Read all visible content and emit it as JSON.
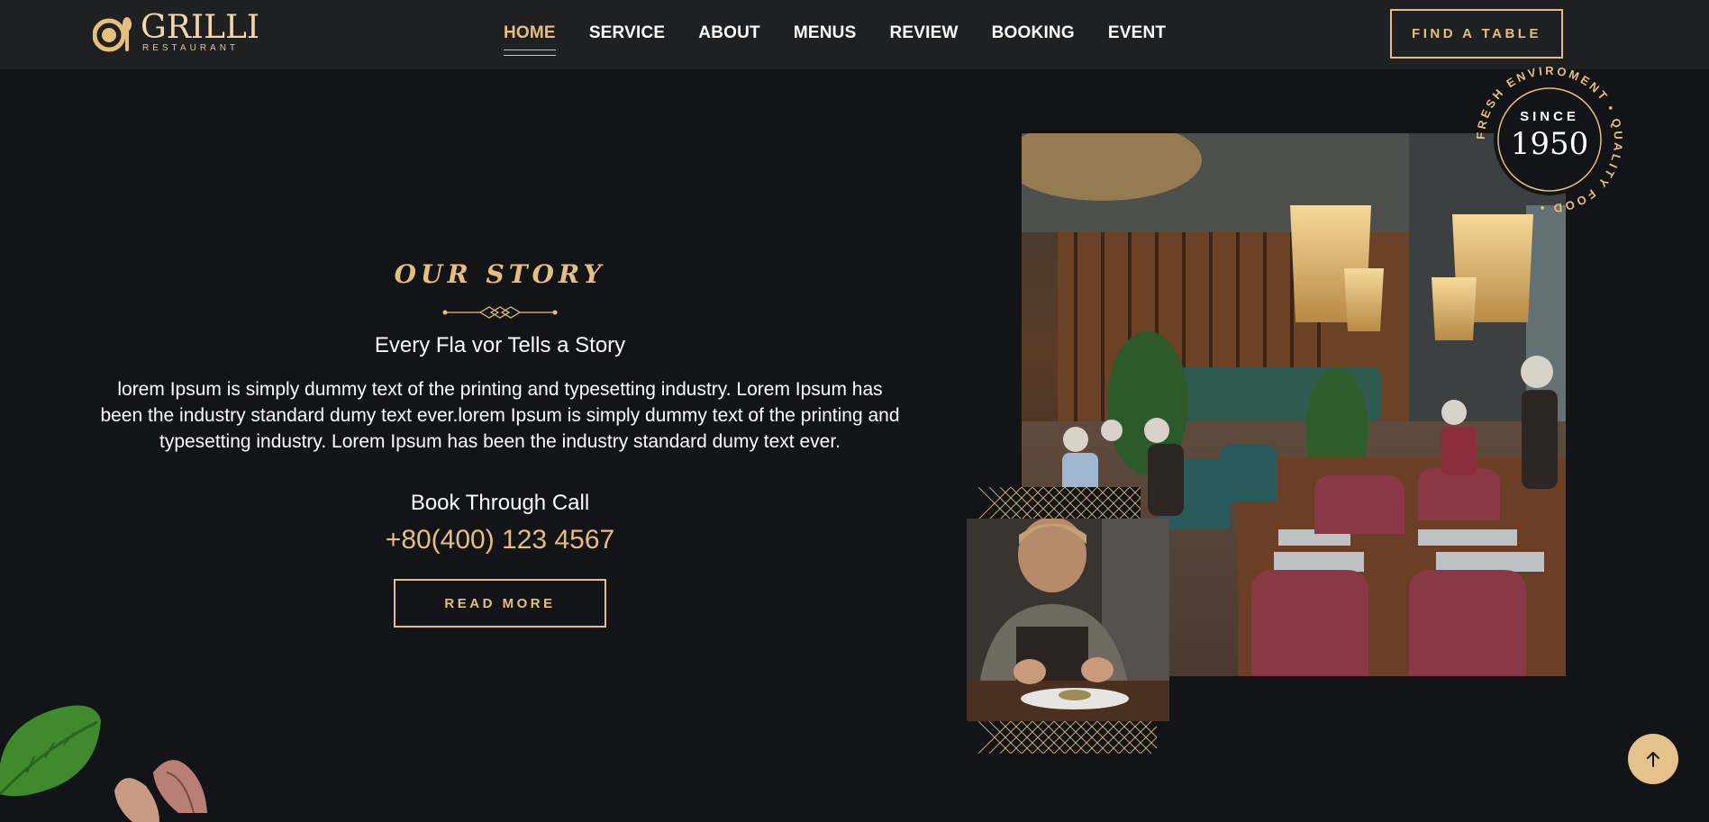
{
  "brand": {
    "name": "GRILLI",
    "tagline": "RESTAURANT"
  },
  "nav": {
    "items": [
      "HOME",
      "SERVICE",
      "ABOUT",
      "MENUS",
      "REVIEW",
      "BOOKING",
      "EVENT"
    ],
    "active": "HOME"
  },
  "header": {
    "cta_label": "FIND A TABLE"
  },
  "story": {
    "eyebrow": "OUR STORY",
    "heading": "Every Fla vor Tells a Story",
    "body": "lorem Ipsum is simply dummy text of the printing and typesetting industry. Lorem Ipsum has been the industry standard dumy text ever.lorem Ipsum is simply dummy text of the printing and typesetting industry. Lorem Ipsum has been the industry standard dumy text ever.",
    "call_label": "Book Through Call",
    "phone": "+80(400) 123 4567",
    "button_label": "READ MORE"
  },
  "badge": {
    "since_label": "SINCE",
    "year": "1950",
    "ring_text": "FRESH ENVIROMENT • QUALITY FOOD •"
  },
  "icons": {
    "scroll_top": "arrow-up-icon",
    "logo": "cloche-spoon-icon"
  },
  "colors": {
    "background": "#131417",
    "header_bg": "#1f2022",
    "accent": "#e6bf7f",
    "text": "#ffffff"
  }
}
